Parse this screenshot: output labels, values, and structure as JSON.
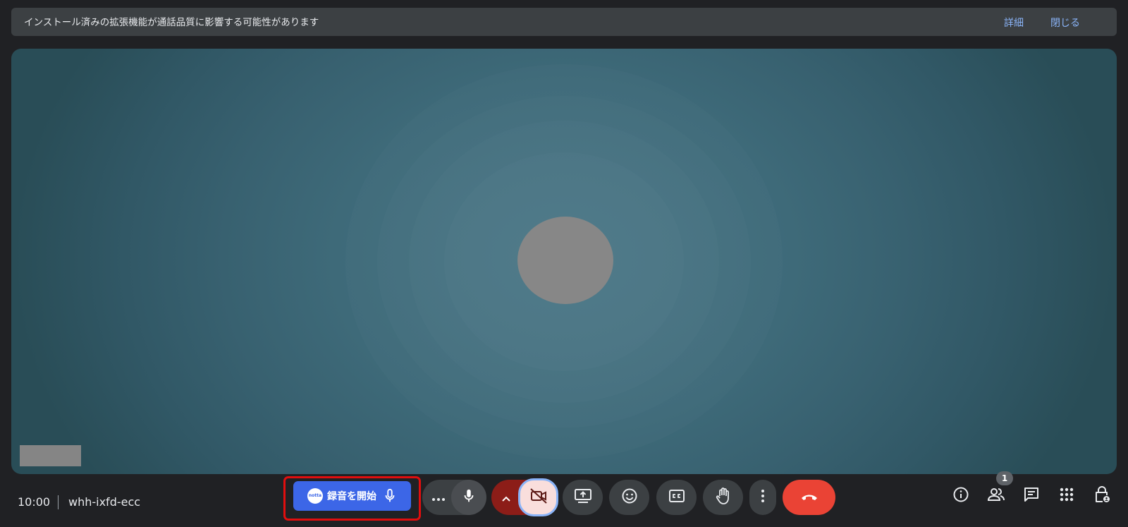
{
  "banner": {
    "message": "インストール済みの拡張機能が通話品質に影響する可能性があります",
    "details_label": "詳細",
    "close_label": "閉じる"
  },
  "meeting": {
    "time": "10:00",
    "code": "whh-ixfd-ecc"
  },
  "recorder": {
    "logo_text": "notta",
    "start_label": "録音を開始"
  },
  "participants": {
    "count": "1"
  },
  "colors": {
    "background": "#202124",
    "banner": "#3c4043",
    "link": "#8ab4f8",
    "record_button": "#3c66e7",
    "highlight_box": "#e10e0e",
    "camera_off": "#f9dedc",
    "hangup": "#ea4335"
  },
  "icons": {
    "more_options_mic": "more-horizontal-icon",
    "mic": "mic-icon",
    "camera_options": "chevron-up-icon",
    "camera": "videocam-off-icon",
    "present": "present-screen-icon",
    "reactions": "emoji-icon",
    "captions": "closed-caption-icon",
    "raise_hand": "hand-icon",
    "more": "more-vertical-icon",
    "hangup": "call-end-icon",
    "info": "info-icon",
    "people": "people-icon",
    "chat": "chat-icon",
    "activities": "apps-grid-icon",
    "host_controls": "lock-person-icon"
  }
}
